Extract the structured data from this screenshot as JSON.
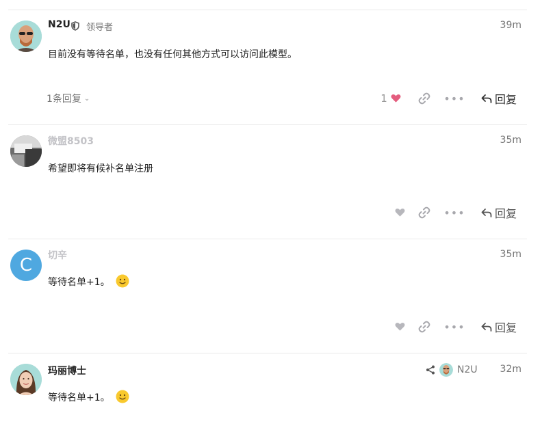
{
  "posts": [
    {
      "username": "N2U",
      "user_title": "领导者",
      "time": "39m",
      "body": "目前没有等待名单，也没有任何其他方式可以访问此模型。",
      "replies_label": "1条回复",
      "like_count": "1",
      "reply_label": "回复",
      "avatar_icon": "bald-man-sunglasses-avatar"
    },
    {
      "username": "微盟8503",
      "time": "35m",
      "body": "希望即将有候补名单注册",
      "reply_label": "回复",
      "avatar_icon": "photo-avatar"
    },
    {
      "username": "切辛",
      "time": "35m",
      "body": "等待名单+1。",
      "reply_label": "回复",
      "avatar_letter": "C"
    },
    {
      "username": "玛丽博士",
      "time": "32m",
      "body": "等待名单+1。",
      "reply_to_user": "N2U",
      "avatar_icon": "woman-portrait-avatar"
    }
  ],
  "colors": {
    "like_active": "#e45d7e",
    "icon_muted": "#a8a8ad",
    "letter_avatar_bg": "#4fa8e0",
    "divider": "#e9e9e9"
  }
}
